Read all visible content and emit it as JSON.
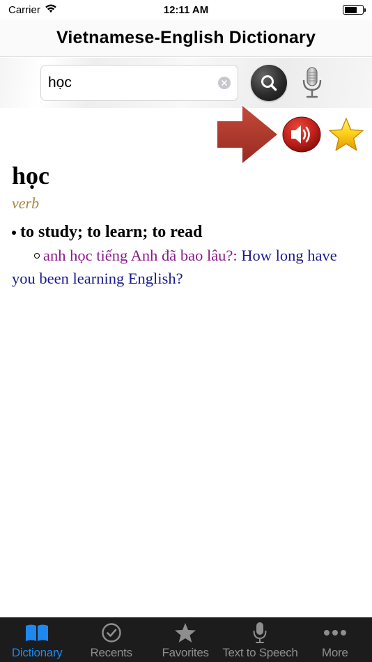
{
  "status_bar": {
    "carrier": "Carrier",
    "time": "12:11 AM"
  },
  "nav": {
    "title": "Vietnamese-English Dictionary"
  },
  "search": {
    "value": "học",
    "placeholder": ""
  },
  "entry": {
    "headword": "học",
    "part_of_speech": "verb",
    "senses": [
      {
        "definition": "to study; to learn; to read",
        "examples": [
          {
            "vietnamese": "anh học tiếng Anh đã bao lâu?:",
            "english": "How long have you been learning English?"
          }
        ]
      }
    ]
  },
  "tabs": [
    {
      "label": "Dictionary",
      "icon": "book-icon",
      "active": true
    },
    {
      "label": "Recents",
      "icon": "clock-check-icon",
      "active": false
    },
    {
      "label": "Favorites",
      "icon": "star-icon",
      "active": false
    },
    {
      "label": "Text to Speech",
      "icon": "microphone-icon",
      "active": false
    },
    {
      "label": "More",
      "icon": "more-dots-icon",
      "active": false
    }
  ],
  "colors": {
    "accent": "#1e88f0",
    "part_of_speech": "#a8873c",
    "example_vietnamese": "#8b1a8b",
    "example_english": "#1a1a8b",
    "tab_bar_bg": "#1c1c1c",
    "speaker_red": "#c0201a",
    "arrow_red": "#b0342a",
    "star_gold": "#f7c600"
  }
}
